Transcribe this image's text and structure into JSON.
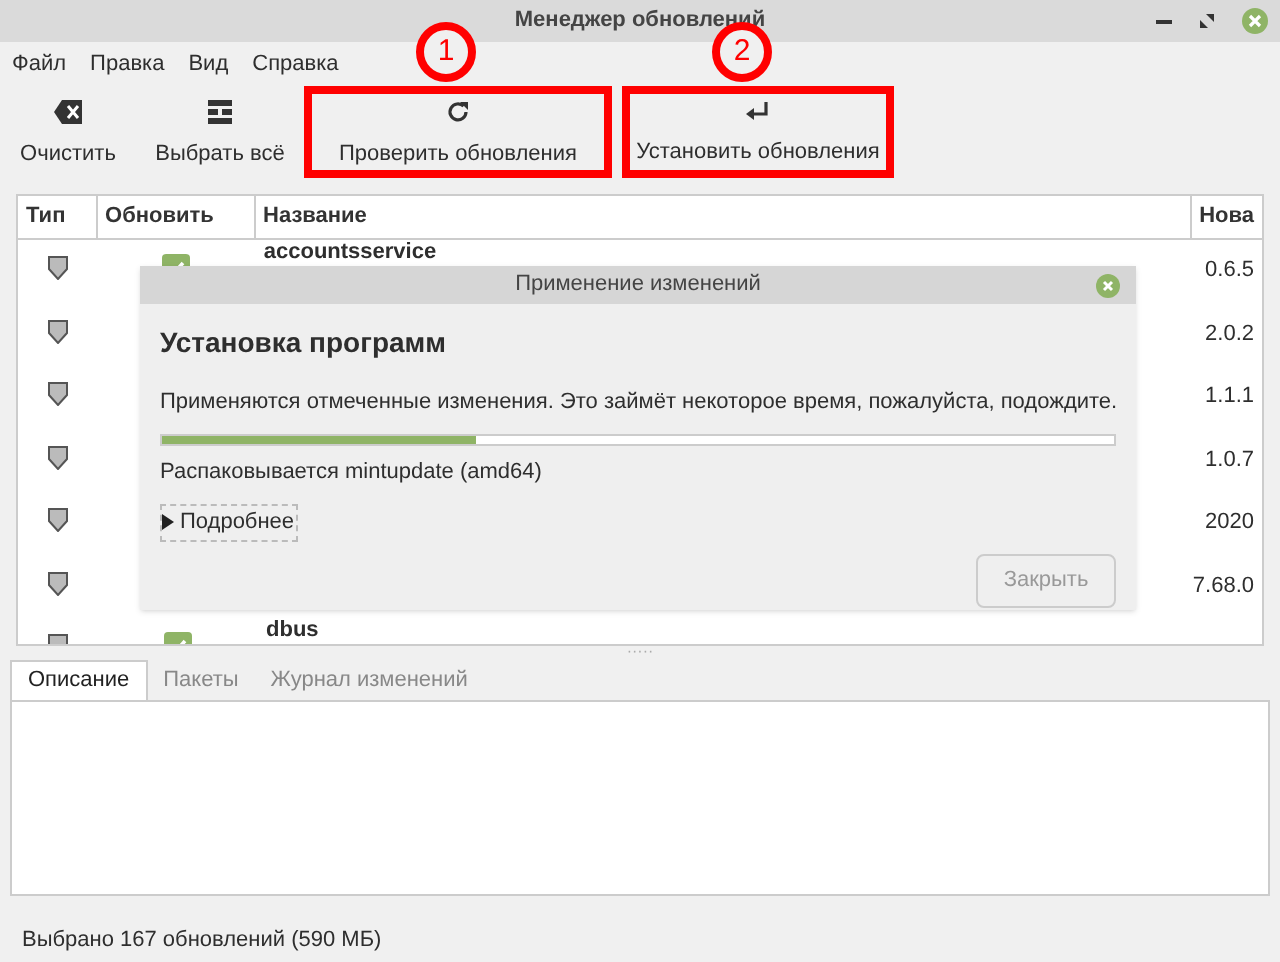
{
  "window": {
    "title": "Менеджер обновлений"
  },
  "menu": [
    "Файл",
    "Правка",
    "Вид",
    "Справка"
  ],
  "toolbar": [
    {
      "kind": "clear",
      "label": "Очистить"
    },
    {
      "kind": "select",
      "label": "Выбрать всё"
    },
    {
      "kind": "refresh",
      "label": "Проверить обновления"
    },
    {
      "kind": "install",
      "label": "Установить обновления"
    }
  ],
  "table": {
    "columns": [
      "Тип",
      "Обновить",
      "Название",
      "Нова"
    ],
    "rows": [
      {
        "checked": true,
        "name": "accountsservice",
        "version": "0.6.5"
      },
      {
        "version": "2.0.2"
      },
      {
        "version": "1.1.1"
      },
      {
        "version": "1.0.7"
      },
      {
        "version": "2020"
      },
      {
        "version": "7.68.0"
      },
      {
        "checked": true,
        "name": "dbus"
      }
    ]
  },
  "dialog": {
    "title": "Применение изменений",
    "heading": "Установка программ",
    "message": "Применяются отмеченные изменения. Это займёт некоторое время, пожалуйста, подождите.",
    "level": 0.33,
    "status": "Распаковывается mintupdate (amd64)",
    "details": {
      "label": "Подробнее",
      "expanded": false
    },
    "button": {
      "label": "Закрыть",
      "disabled": true
    }
  },
  "tabs": [
    {
      "label": "Описание",
      "selected": true
    },
    {
      "label": "Пакеты",
      "selected": false
    },
    {
      "label": "Журнал изменений",
      "selected": false
    }
  ],
  "status_bar": "Выбрано 167 обновлений (590 МБ)",
  "pane_handle": "·····",
  "annotations": [
    {
      "number": "1"
    },
    {
      "number": "2"
    }
  ]
}
